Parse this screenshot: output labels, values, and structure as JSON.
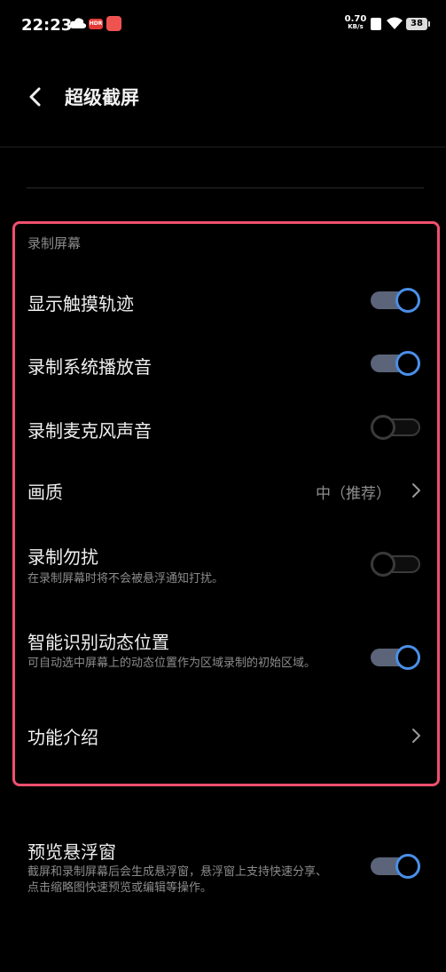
{
  "status_bar": {
    "time": "22:23",
    "net_speed_value": "0.70",
    "net_speed_unit": "KB/s",
    "hdr_badge": "HDR",
    "battery": "38",
    "icons": [
      "cloud-icon",
      "hdr-icon",
      "app-notification-icon",
      "no-sim-icon",
      "wifi-icon",
      "battery-icon"
    ]
  },
  "header": {
    "title": "超级截屏",
    "back_icon": "chevron-left-icon"
  },
  "section": {
    "label": "录制屏幕"
  },
  "settings": [
    {
      "title": "显示触摸轨迹",
      "control": "toggle",
      "on": true
    },
    {
      "title": "录制系统播放音",
      "control": "toggle",
      "on": true
    },
    {
      "title": "录制麦克风声音",
      "control": "toggle",
      "on": false
    },
    {
      "title": "画质",
      "control": "link",
      "value": "中（推荐）"
    },
    {
      "title": "录制勿扰",
      "subtitle": "在录制屏幕时将不会被悬浮通知打扰。",
      "control": "toggle",
      "on": false
    },
    {
      "title": "智能识别动态位置",
      "subtitle": "可自动选中屏幕上的动态位置作为区域录制的初始区域。",
      "control": "toggle",
      "on": true
    },
    {
      "title": "功能介绍",
      "control": "link"
    }
  ],
  "preview": {
    "title": "预览悬浮窗",
    "subtitle": "截屏和录制屏幕后会生成悬浮窗，悬浮窗上支持快速分享、点击缩略图快速预览或编辑等操作。",
    "on": true
  },
  "colors": {
    "background": "#000000",
    "toggle_accent": "#4a8fe8",
    "highlight_border": "#f0506e"
  }
}
